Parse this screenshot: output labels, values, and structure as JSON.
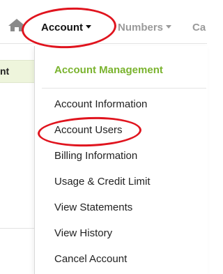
{
  "navbar": {
    "home_icon": "home-icon",
    "items": [
      {
        "label": "Account",
        "active": true
      },
      {
        "label": "Numbers",
        "active": false
      },
      {
        "label": "Ca",
        "active": false
      }
    ]
  },
  "left_panel": {
    "header_fragment": "nt"
  },
  "dropdown": {
    "header": "Account Management",
    "items": [
      {
        "label": "Account Information"
      },
      {
        "label": "Account Users",
        "highlighted": true
      },
      {
        "label": "Billing Information"
      },
      {
        "label": "Usage & Credit Limit"
      },
      {
        "label": "View Statements"
      },
      {
        "label": "View History"
      },
      {
        "label": "Cancel Account"
      }
    ]
  },
  "colors": {
    "accent_green": "#7ab32e",
    "annotation_red": "#e0141e",
    "inactive_nav": "#9a9a9a",
    "header_strip_bg": "#eef5dc"
  }
}
